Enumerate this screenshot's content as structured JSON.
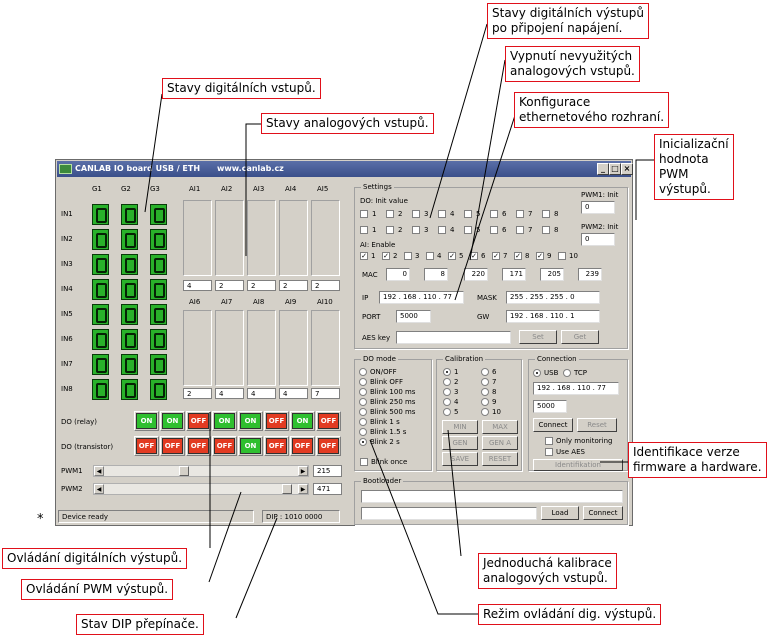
{
  "window": {
    "title": "CANLAB IO board USB / ETH",
    "url": "www.canlab.cz",
    "min": "_",
    "max": "□",
    "close": "×"
  },
  "digital_inputs": {
    "columns": [
      "G1",
      "G2",
      "G3"
    ],
    "rows": [
      "IN1",
      "IN2",
      "IN3",
      "IN4",
      "IN5",
      "IN6",
      "IN7",
      "IN8"
    ],
    "state_color": "#29b12a"
  },
  "analog_inputs": {
    "top_labels": [
      "AI1",
      "AI2",
      "AI3",
      "AI4",
      "AI5"
    ],
    "top_values": [
      "4",
      "2",
      "2",
      "2",
      "2"
    ],
    "bottom_labels": [
      "AI6",
      "AI7",
      "AI8",
      "AI9",
      "AI10"
    ],
    "bottom_values": [
      "2",
      "4",
      "4",
      "4",
      "7"
    ]
  },
  "outputs": {
    "relay_label": "DO (relay)",
    "transistor_label": "DO (transistor)",
    "relay": [
      "ON",
      "ON",
      "OFF",
      "ON",
      "ON",
      "OFF",
      "ON",
      "OFF"
    ],
    "transistor": [
      "OFF",
      "OFF",
      "OFF",
      "OFF",
      "ON",
      "OFF",
      "OFF",
      "OFF"
    ],
    "on_color": "#2fbf2f",
    "off_color": "#e23b22"
  },
  "pwm": {
    "pwm1_label": "PWM1",
    "pwm1_value": "215",
    "pwm2_label": "PWM2",
    "pwm2_value": "471",
    "left_arrow": "◀",
    "right_arrow": "▶"
  },
  "status": {
    "device": "Device ready",
    "dip": "DIP : 1010 0000"
  },
  "settings": {
    "title": "Settings",
    "do_init_label": "DO: Init value",
    "do_init_numbers": [
      "1",
      "2",
      "3",
      "4",
      "5",
      "6",
      "7",
      "8"
    ],
    "ai_enable_label": "AI: Enable",
    "ai_enable_numbers": [
      "1",
      "2",
      "3",
      "4",
      "5",
      "6",
      "7",
      "8",
      "9",
      "10"
    ],
    "ai_enable_checked": [
      true,
      true,
      false,
      false,
      true,
      true,
      true,
      true,
      true,
      false
    ],
    "check_mark": "✓",
    "pwm1_init_label": "PWM1: Init",
    "pwm1_init_value": "0",
    "pwm2_init_label": "PWM2: Init",
    "pwm2_init_value": "0",
    "mac_label": "MAC",
    "mac": [
      "0",
      "8",
      "220",
      "171",
      "205",
      "239"
    ],
    "ip_label": "IP",
    "ip": "192 . 168 . 110 . 77",
    "mask_label": "MASK",
    "mask": "255 . 255 . 255 . 0",
    "port_label": "PORT",
    "port": "5000",
    "gw_label": "GW",
    "gw": "192 . 168 . 110 . 1",
    "aes_label": "AES key",
    "aes_value": "",
    "set_button": "Set",
    "get_button": "Get"
  },
  "do_mode": {
    "title": "DO mode",
    "options": [
      "ON/OFF",
      "Blink OFF",
      "Blink 100 ms",
      "Blink 250 ms",
      "Blink 500 ms",
      "Blink 1 s",
      "Blink 1.5 s",
      "Blink 2 s"
    ],
    "selected": "Blink 2 s",
    "blink_once": "Blink once"
  },
  "calibration": {
    "title": "Calibration",
    "options": [
      "1",
      "2",
      "3",
      "4",
      "5",
      "6",
      "7",
      "8",
      "9",
      "10"
    ],
    "selected": "1",
    "buttons": [
      "MIN",
      "MAX",
      "GEN",
      "GEN A",
      "SAVE",
      "RESET"
    ]
  },
  "connection": {
    "title": "Connection",
    "usb": "USB",
    "tcp": "TCP",
    "ip": "192 . 168 . 110 . 77",
    "port": "5000",
    "connect": "Connect",
    "reset": "Reset",
    "only_monitoring": "Only monitoring",
    "use_aes": "Use AES",
    "identification": "Identifikation"
  },
  "bootloader": {
    "title": "Bootloader",
    "load": "Load",
    "connect": "Connect"
  },
  "asterisk": "*",
  "callouts": {
    "stavy_dig_vystupu": "Stavy digitálních výstupů\npo připojení napájení.",
    "vypnuti_analog": "Vypnutí nevyužitých\nanalogových vstupů.",
    "stavy_dig_vstupu": "Stavy digitálních vstupů.",
    "konfigurace_eth": "Konfigurace\nethernetového rozhraní.",
    "stavy_analog": "Stavy analogových vstupů.",
    "init_pwm": "Inicializační\nhodnota\nPWM\nvýstupů.",
    "identifikace": "Identifikace verze\nfirmware a hardware.",
    "ovladani_dig": "Ovládání digitálních výstupů.",
    "ovladani_pwm": "Ovládání PWM výstupů.",
    "stav_dip": "Stav DIP přepínače.",
    "kalibrace": "Jednoduchá kalibrace\nanalogových vstupů.",
    "rezim": "Režim ovládání dig. výstupů."
  }
}
